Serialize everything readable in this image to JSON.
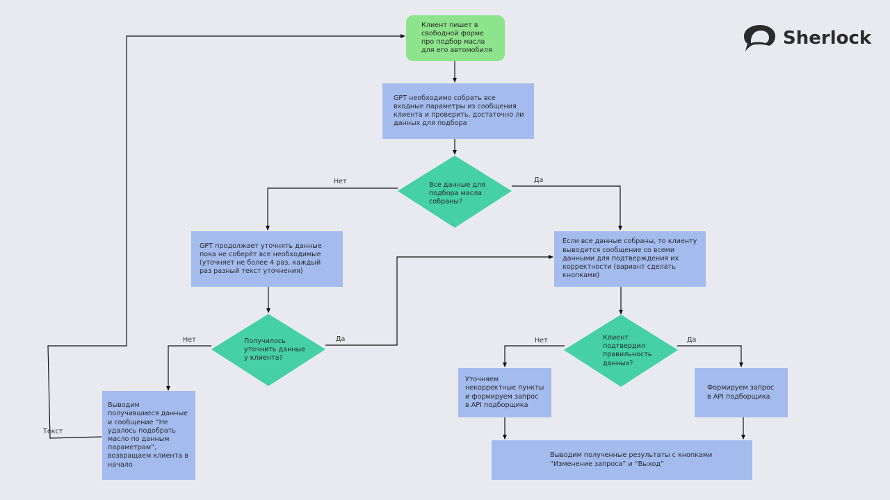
{
  "brand": {
    "name": "Sherlock",
    "icon": "speech-bubble-logo"
  },
  "colors": {
    "background": "#e9eaf0",
    "start": "#8ee48c",
    "process": "#a4bbee",
    "decision": "#45d1a4",
    "line": "#111111"
  },
  "nodes": {
    "start": "Клиент пишет в свободной форме про подбор масла для его автомобиля",
    "collect": "GPT необходимо собрать все входные параметры из сообщения клиента и проверить, достаточно ли данных для подбора",
    "decision_all_collected": "Все данные для подбора масла собраны?",
    "clarify": "GPT продолжает уточнять данные пока не соберёт все необходимые (уточняет не более 4 раз, каждый раз разный текст уточнения)",
    "confirm": "Если все данные собраны, то клиенту выводится сообщение со всеми данными для подтверждения их корректности (вариант сделать кнопками)",
    "decision_clarified": "Получилось уточнить данные у клиента?",
    "decision_confirmed": "Клиент подтвердил правильность данных?",
    "fail_output": "Выводим получившиеся данные и сообщение “Не удалось подобрать масло по данным параметрам”, возвращаем клиента в начало",
    "fix_items": "Уточняем некорректные пункты и формируем запрос в API подборщика",
    "form_request": "Формируем запрос в API подборщика",
    "results": "Выводим полученные результаты с кнопками “Изменение запроса” и “Выход”"
  },
  "labels": {
    "no": "Нет",
    "yes": "Да",
    "text": "Текст"
  }
}
